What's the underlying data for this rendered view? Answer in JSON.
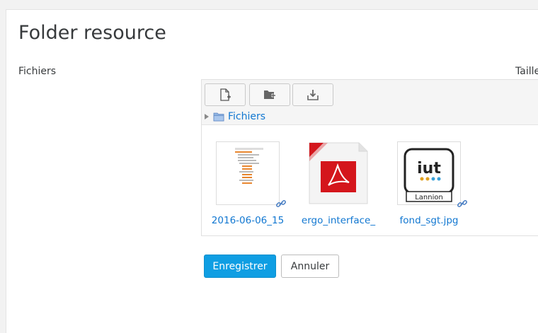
{
  "page": {
    "title": "Folder resource"
  },
  "form": {
    "files_label": "Fichiers",
    "size_column": "Taille"
  },
  "filemanager": {
    "toolbar": {
      "add_file": "add-file-icon",
      "create_folder": "create-folder-icon",
      "download": "download-icon"
    },
    "path": {
      "root": "Fichiers"
    },
    "files": [
      {
        "name": "2016-06-06_15",
        "type": "screenshot",
        "alias": true
      },
      {
        "name": "ergo_interface_",
        "type": "pdf",
        "alias": false
      },
      {
        "name": "fond_sgt.jpg",
        "type": "image",
        "alias": true
      }
    ],
    "logo_text": "Lannion"
  },
  "buttons": {
    "save": "Enregistrer",
    "cancel": "Annuler"
  },
  "colors": {
    "link": "#1177d1",
    "primary": "#0f9ee3",
    "pdf_red": "#d4161c"
  }
}
